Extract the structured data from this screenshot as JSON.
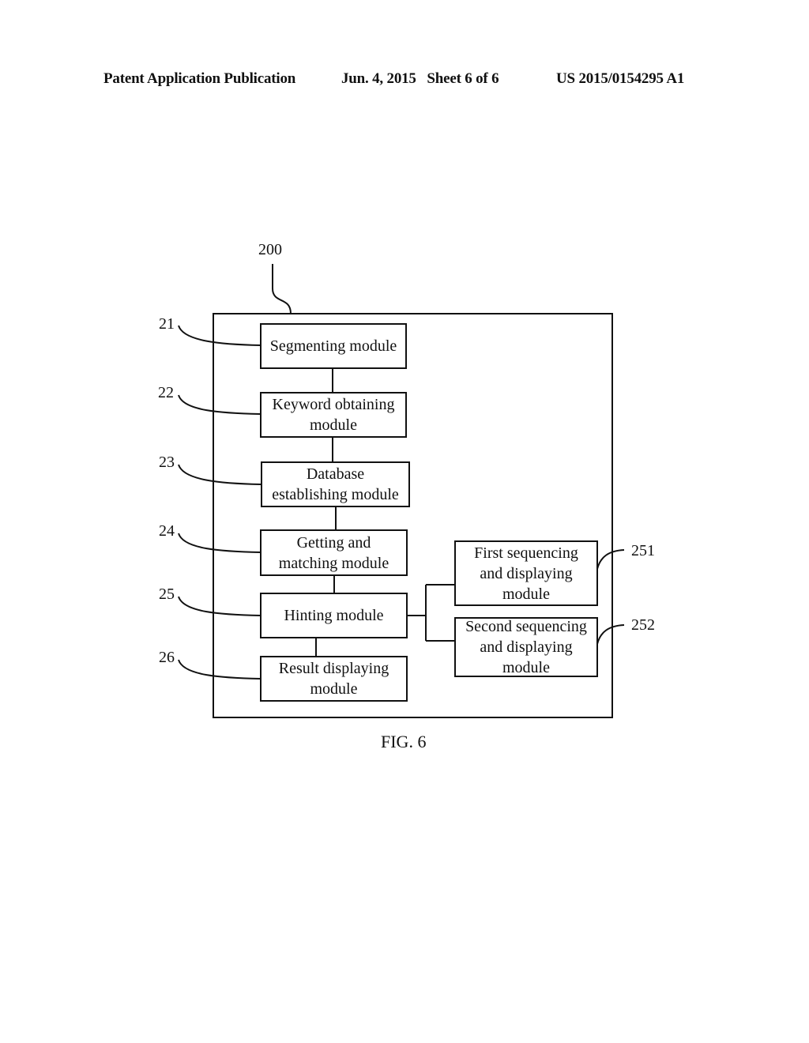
{
  "header": {
    "publication": "Patent Application Publication",
    "date_sheet": "Jun. 4, 2015   Sheet 6 of 6",
    "patent_number": "US 2015/0154295 A1"
  },
  "figure": {
    "caption": "FIG. 6",
    "system_ref": "200",
    "modules": [
      {
        "ref": "21",
        "label": "Segmenting module"
      },
      {
        "ref": "22",
        "label": "Keyword obtaining module"
      },
      {
        "ref": "23",
        "label": "Database establishing module"
      },
      {
        "ref": "24",
        "label": "Getting and matching module"
      },
      {
        "ref": "25",
        "label": "Hinting module"
      },
      {
        "ref": "26",
        "label": "Result displaying module"
      }
    ],
    "submodules": [
      {
        "ref": "251",
        "label": "First sequencing and displaying module"
      },
      {
        "ref": "252",
        "label": "Second sequencing and displaying module"
      }
    ]
  }
}
